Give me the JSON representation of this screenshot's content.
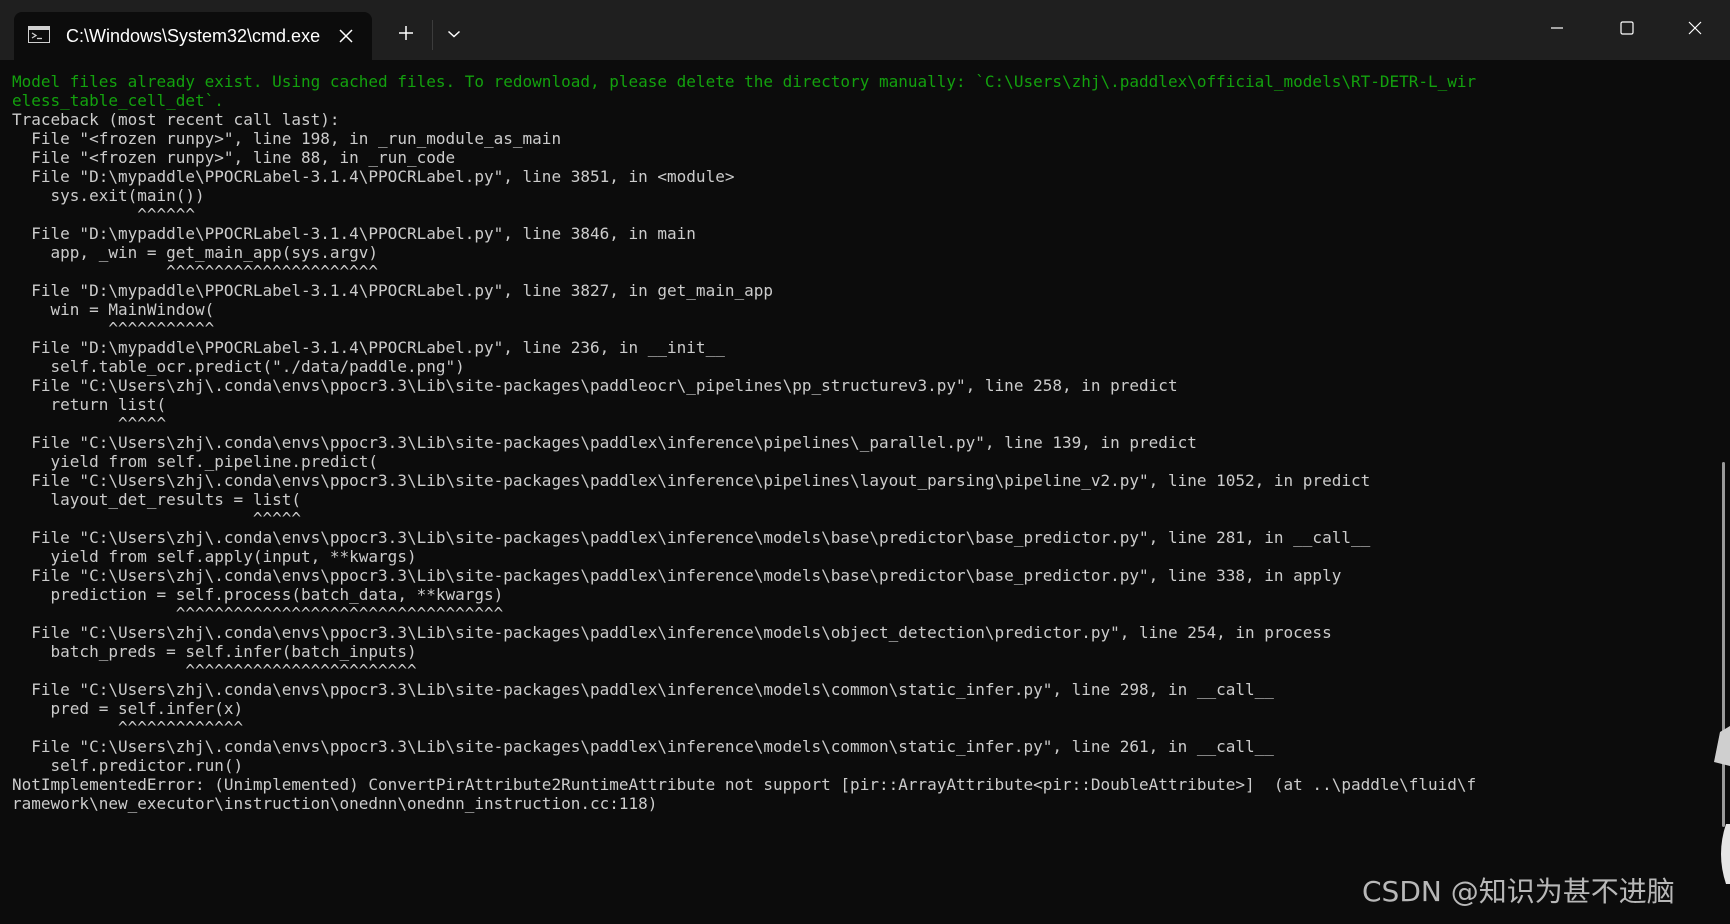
{
  "tab": {
    "title": "C:\\Windows\\System32\\cmd.exe"
  },
  "titlebar": {
    "new_tab_icon": "plus-icon",
    "dropdown_icon": "chevron-down-icon",
    "minimize_icon": "minimize-icon",
    "maximize_icon": "maximize-icon",
    "close_icon": "close-icon"
  },
  "colors": {
    "background": "#0c0c0c",
    "titlebar": "#1f1f1f",
    "text": "#cccccc",
    "green": "#13a10e"
  },
  "console": {
    "lines": [
      "Model files already exist. Using cached files. To redownload, please delete the directory manually: `C:\\Users\\zhj\\.paddlex\\official_models\\RT-DETR-L_wir",
      "eless_table_cell_det`.",
      "Traceback (most recent call last):",
      "  File \"<frozen runpy>\", line 198, in _run_module_as_main",
      "  File \"<frozen runpy>\", line 88, in _run_code",
      "  File \"D:\\mypaddle\\PPOCRLabel-3.1.4\\PPOCRLabel.py\", line 3851, in <module>",
      "    sys.exit(main())",
      "             ^^^^^^",
      "  File \"D:\\mypaddle\\PPOCRLabel-3.1.4\\PPOCRLabel.py\", line 3846, in main",
      "    app, _win = get_main_app(sys.argv)",
      "                ^^^^^^^^^^^^^^^^^^^^^^",
      "  File \"D:\\mypaddle\\PPOCRLabel-3.1.4\\PPOCRLabel.py\", line 3827, in get_main_app",
      "    win = MainWindow(",
      "          ^^^^^^^^^^^",
      "  File \"D:\\mypaddle\\PPOCRLabel-3.1.4\\PPOCRLabel.py\", line 236, in __init__",
      "    self.table_ocr.predict(\"./data/paddle.png\")",
      "  File \"C:\\Users\\zhj\\.conda\\envs\\ppocr3.3\\Lib\\site-packages\\paddleocr\\_pipelines\\pp_structurev3.py\", line 258, in predict",
      "    return list(",
      "           ^^^^^",
      "  File \"C:\\Users\\zhj\\.conda\\envs\\ppocr3.3\\Lib\\site-packages\\paddlex\\inference\\pipelines\\_parallel.py\", line 139, in predict",
      "    yield from self._pipeline.predict(",
      "  File \"C:\\Users\\zhj\\.conda\\envs\\ppocr3.3\\Lib\\site-packages\\paddlex\\inference\\pipelines\\layout_parsing\\pipeline_v2.py\", line 1052, in predict",
      "    layout_det_results = list(",
      "                         ^^^^^",
      "  File \"C:\\Users\\zhj\\.conda\\envs\\ppocr3.3\\Lib\\site-packages\\paddlex\\inference\\models\\base\\predictor\\base_predictor.py\", line 281, in __call__",
      "    yield from self.apply(input, **kwargs)",
      "  File \"C:\\Users\\zhj\\.conda\\envs\\ppocr3.3\\Lib\\site-packages\\paddlex\\inference\\models\\base\\predictor\\base_predictor.py\", line 338, in apply",
      "    prediction = self.process(batch_data, **kwargs)",
      "                 ^^^^^^^^^^^^^^^^^^^^^^^^^^^^^^^^^^",
      "  File \"C:\\Users\\zhj\\.conda\\envs\\ppocr3.3\\Lib\\site-packages\\paddlex\\inference\\models\\object_detection\\predictor.py\", line 254, in process",
      "    batch_preds = self.infer(batch_inputs)",
      "                  ^^^^^^^^^^^^^^^^^^^^^^^^",
      "  File \"C:\\Users\\zhj\\.conda\\envs\\ppocr3.3\\Lib\\site-packages\\paddlex\\inference\\models\\common\\static_infer.py\", line 298, in __call__",
      "    pred = self.infer(x)",
      "           ^^^^^^^^^^^^^",
      "  File \"C:\\Users\\zhj\\.conda\\envs\\ppocr3.3\\Lib\\site-packages\\paddlex\\inference\\models\\common\\static_infer.py\", line 261, in __call__",
      "    self.predictor.run()",
      "NotImplementedError: (Unimplemented) ConvertPirAttribute2RuntimeAttribute not support [pir::ArrayAttribute<pir::DoubleAttribute>]  (at ..\\paddle\\fluid\\f",
      "ramework\\new_executor\\instruction\\onednn\\onednn_instruction.cc:118)"
    ]
  },
  "watermark": "CSDN @知识为甚不进脑"
}
